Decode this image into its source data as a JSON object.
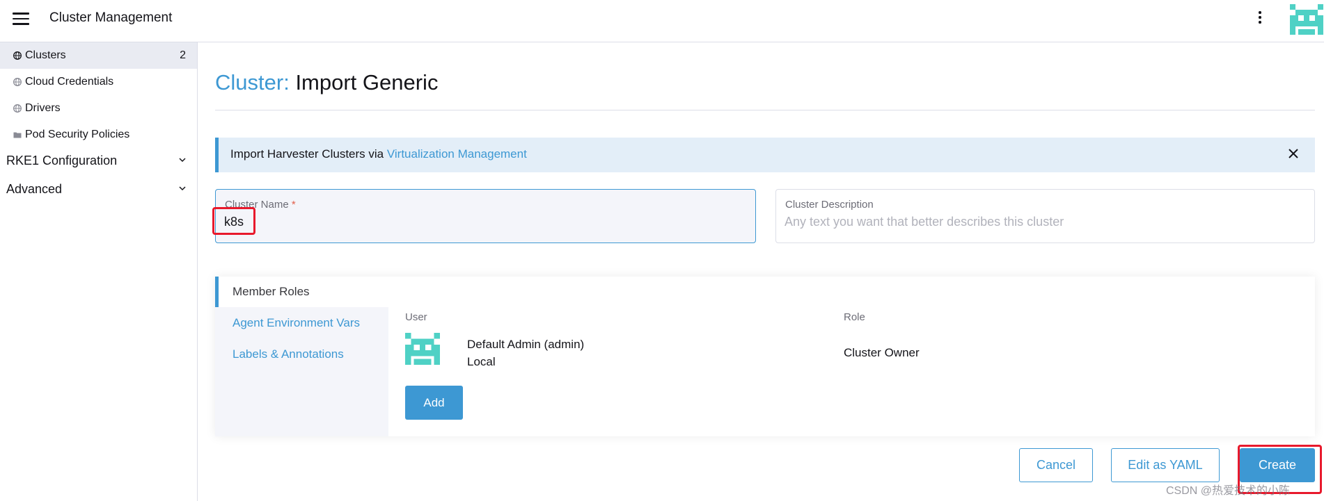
{
  "header": {
    "title": "Cluster Management",
    "menu_icon": "hamburger-menu-icon",
    "more_icon": "kebab-menu-icon",
    "avatar_color": "#4fd1c5"
  },
  "sidebar": {
    "items": [
      {
        "label": "Clusters",
        "count": "2",
        "icon": "globe-icon"
      },
      {
        "label": "Cloud Credentials",
        "icon": "globe-icon"
      },
      {
        "label": "Drivers",
        "icon": "globe-icon"
      },
      {
        "label": "Pod Security Policies",
        "icon": "folder-icon"
      }
    ],
    "groups": [
      {
        "label": "RKE1 Configuration"
      },
      {
        "label": "Advanced"
      }
    ]
  },
  "page": {
    "resource": "Cluster:",
    "title": "Import Generic"
  },
  "banner": {
    "text": "Import Harvester Clusters via ",
    "link": "Virtualization Management"
  },
  "form": {
    "name": {
      "label": "Cluster Name",
      "required_mark": "*",
      "value": "k8s"
    },
    "description": {
      "label": "Cluster Description",
      "placeholder": "Any text you want that better describes this cluster",
      "value": ""
    }
  },
  "tabs": {
    "items": [
      {
        "label": "Member Roles",
        "active": true
      },
      {
        "label": "Agent Environment Vars",
        "active": false
      },
      {
        "label": "Labels & Annotations",
        "active": false
      }
    ],
    "member_roles": {
      "user_header": "User",
      "role_header": "Role",
      "user_name": "Default Admin (admin)",
      "user_provider": "Local",
      "role": "Cluster Owner",
      "add_label": "Add"
    }
  },
  "footer": {
    "cancel": "Cancel",
    "edit_yaml": "Edit as YAML",
    "create": "Create"
  },
  "watermark": "CSDN @热爱技术的小陈",
  "colors": {
    "accent": "#3d98d3",
    "highlight_box": "#e8192c"
  }
}
